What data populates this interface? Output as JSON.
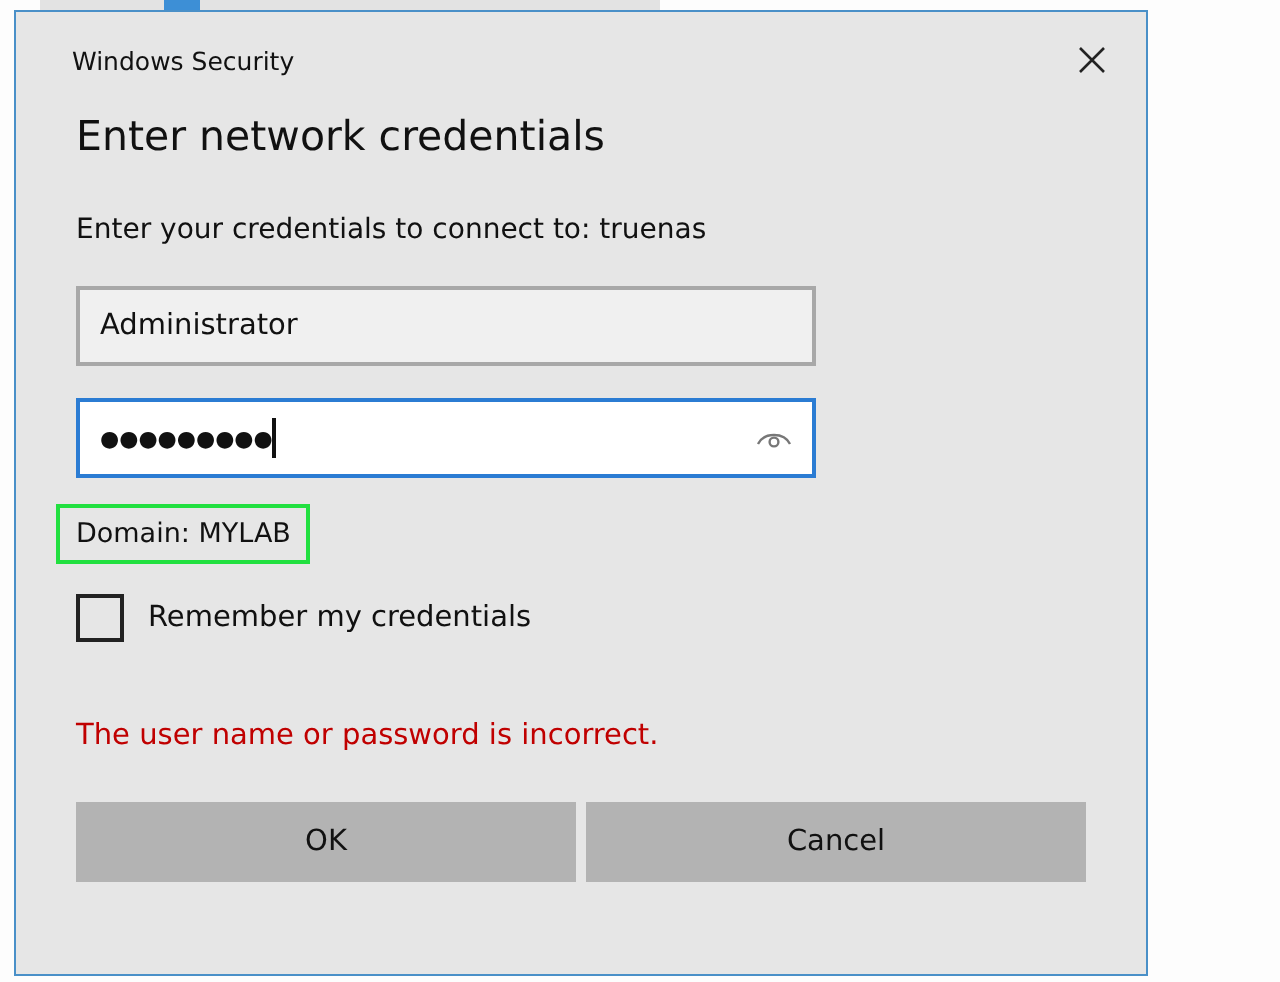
{
  "window": {
    "title": "Windows Security"
  },
  "heading": "Enter network credentials",
  "prompt": "Enter your credentials to connect to: truenas",
  "username": {
    "value": "Administrator"
  },
  "password": {
    "value": "●●●●●●●●●",
    "focused": true
  },
  "domain": "Domain: MYLAB",
  "remember": {
    "label": "Remember my credentials",
    "checked": false
  },
  "error": "The user name or password is incorrect.",
  "buttons": [
    "OK",
    "Cancel"
  ]
}
